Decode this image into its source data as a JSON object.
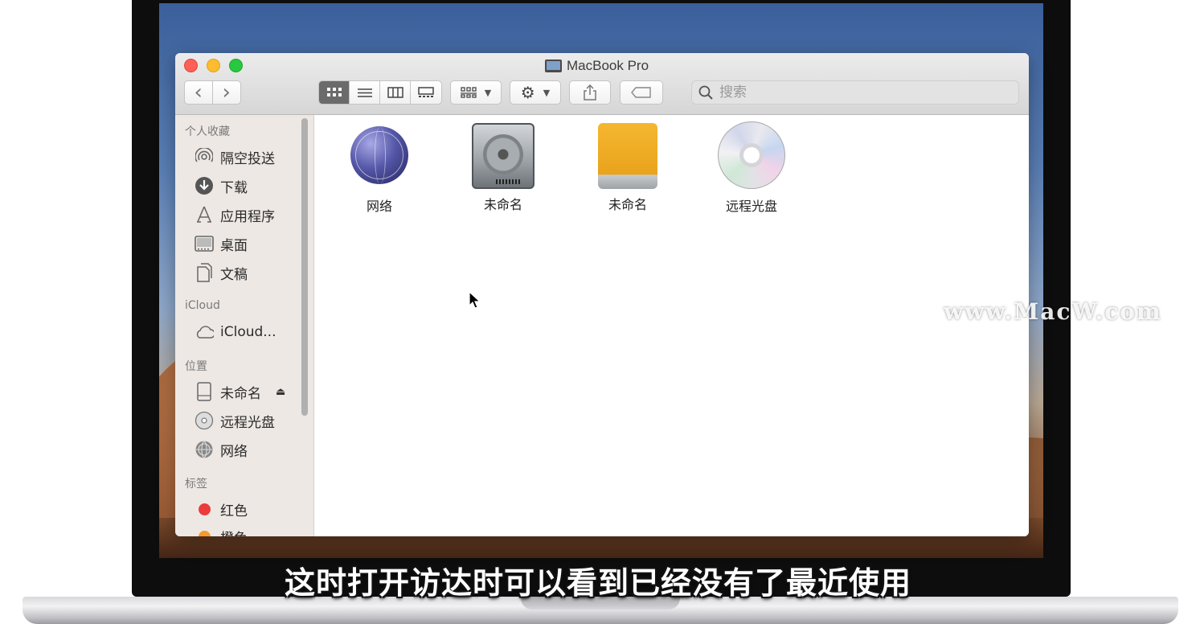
{
  "window": {
    "title": "MacBook Pro"
  },
  "toolbar": {
    "back_glyph": "‹",
    "forward_glyph": "›",
    "views": [
      "icon-view",
      "list-view",
      "column-view",
      "gallery-view"
    ],
    "active_view": "icon-view",
    "search_placeholder": "搜索"
  },
  "sidebar": {
    "sections": [
      {
        "title": "个人收藏",
        "items": [
          {
            "label": "隔空投送",
            "icon": "airdrop-icon"
          },
          {
            "label": "下载",
            "icon": "download-icon"
          },
          {
            "label": "应用程序",
            "icon": "applications-icon"
          },
          {
            "label": "桌面",
            "icon": "desktop-icon"
          },
          {
            "label": "文稿",
            "icon": "documents-icon"
          }
        ]
      },
      {
        "title": "iCloud",
        "items": [
          {
            "label": "iCloud...",
            "icon": "cloud-icon"
          }
        ]
      },
      {
        "title": "位置",
        "items": [
          {
            "label": "未命名",
            "icon": "disk-icon",
            "eject": "⏏"
          },
          {
            "label": "远程光盘",
            "icon": "remote-disc-icon"
          },
          {
            "label": "网络",
            "icon": "network-icon"
          }
        ]
      },
      {
        "title": "标签",
        "items": [
          {
            "label": "红色",
            "color": "#ec3b3b"
          },
          {
            "label": "橙色",
            "color": "#f59a2a"
          }
        ]
      }
    ]
  },
  "files": [
    {
      "label": "网络",
      "icon": "network-globe-icon"
    },
    {
      "label": "未命名",
      "icon": "hard-drive-icon"
    },
    {
      "label": "未命名",
      "icon": "external-drive-icon"
    },
    {
      "label": "远程光盘",
      "icon": "optical-disc-icon"
    }
  ],
  "watermark": "www.MacW.com",
  "subtitle": "这时打开访达时可以看到已经没有了最近使用"
}
